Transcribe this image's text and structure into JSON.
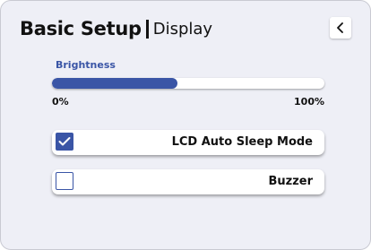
{
  "header": {
    "title": "Basic Setup",
    "subtitle": "Display",
    "back_icon": "chevron-left-icon"
  },
  "brightness": {
    "label": "Brightness",
    "min_label": "0%",
    "max_label": "100%",
    "value_percent": 46
  },
  "options": [
    {
      "label": "LCD Auto Sleep Mode",
      "checked": true
    },
    {
      "label": "Buzzer",
      "checked": false
    }
  ],
  "colors": {
    "accent": "#3a55a6",
    "background": "#eeeff6",
    "text": "#111111",
    "card": "#ffffff"
  }
}
